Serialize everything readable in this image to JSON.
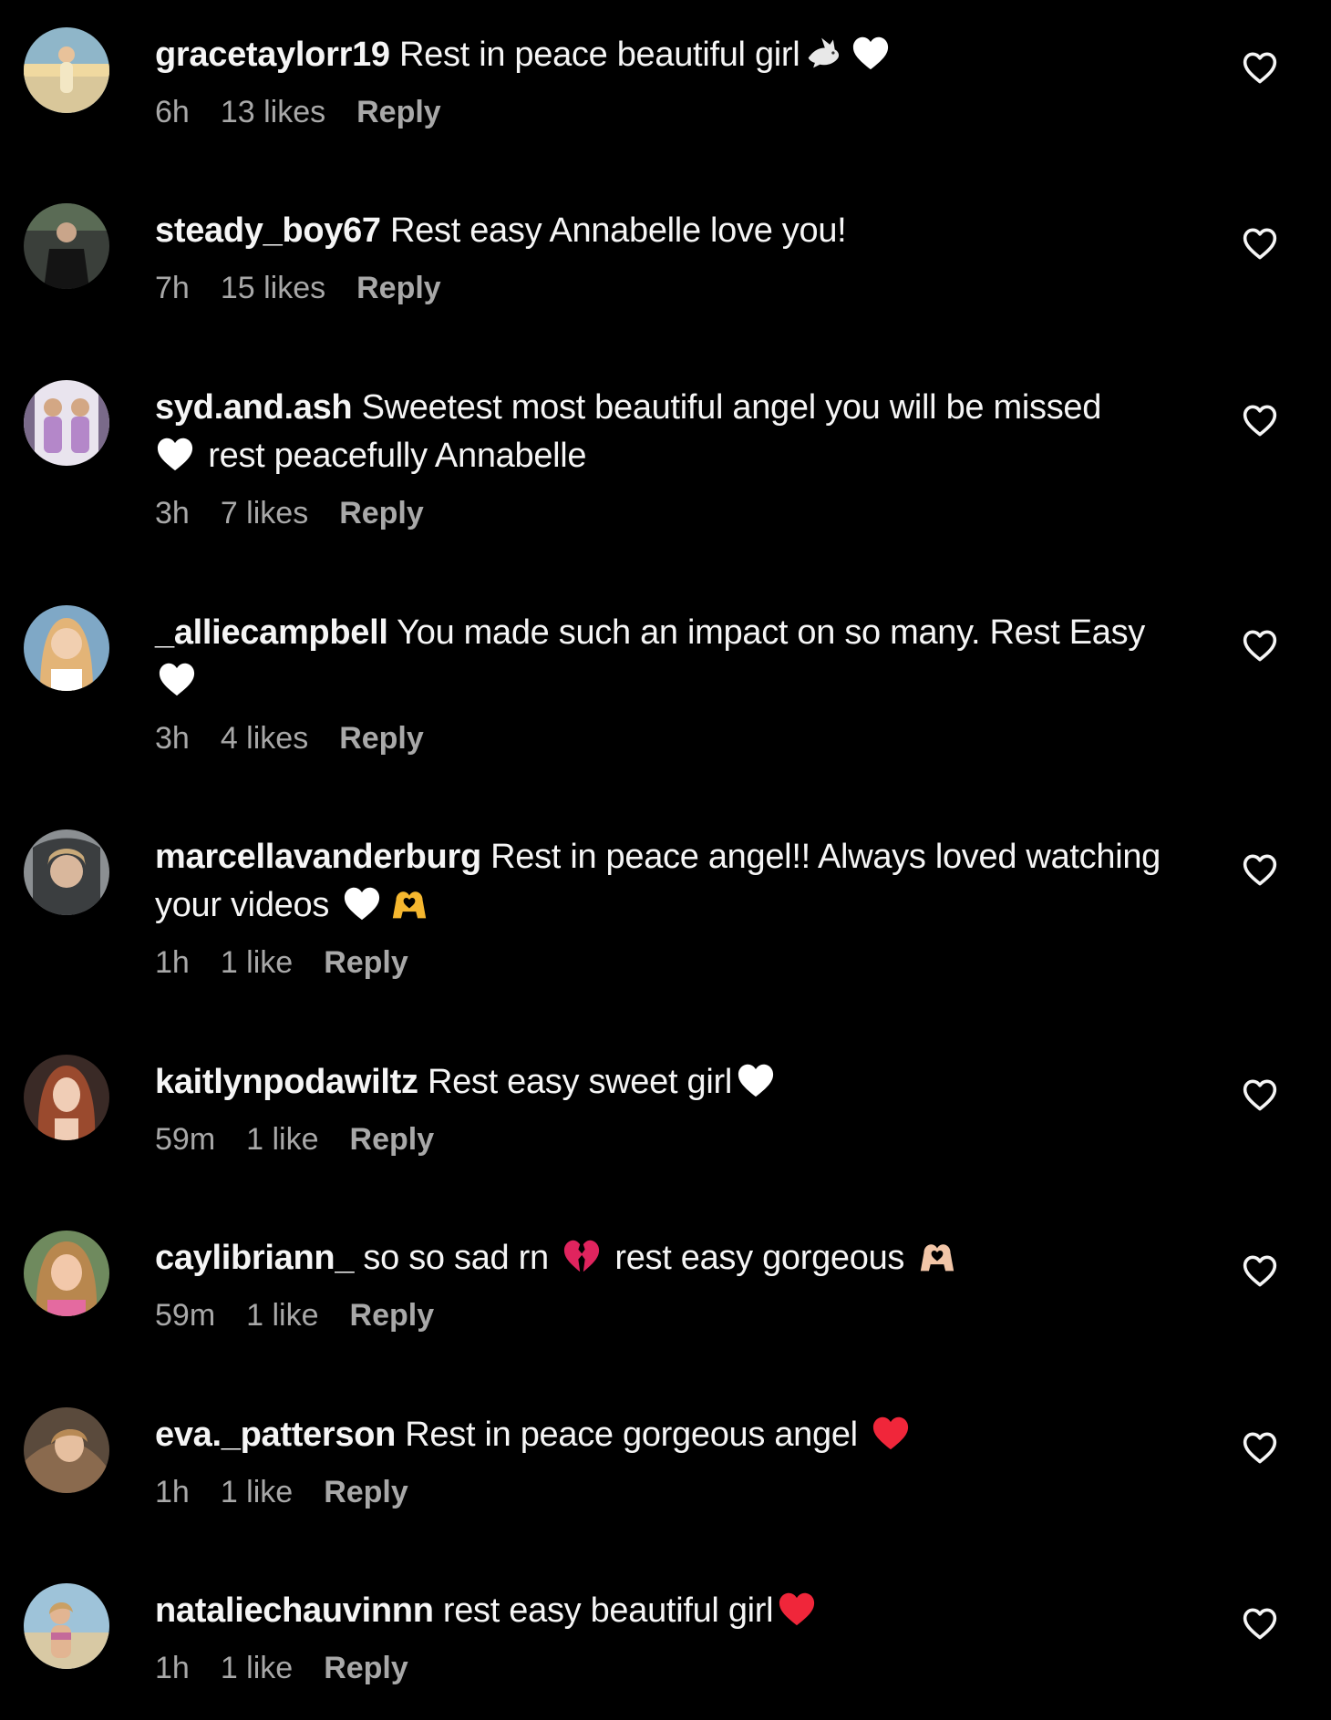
{
  "colors": {
    "background": "#000000",
    "text": "#f5f5f5",
    "meta": "#a8a8a8",
    "white_heart": "#ffffff",
    "red_heart": "#f0263a",
    "gold_hands": "#f5b72f",
    "peach_hands": "#f2c6a8"
  },
  "comments": [
    {
      "username": "gracetaylorr19",
      "text": " Rest in peace beautiful girl",
      "emoji": [
        "dove",
        "white-heart"
      ],
      "time": "6h",
      "likes": "13 likes",
      "reply": "Reply"
    },
    {
      "username": "steady_boy67",
      "text": " Rest easy Annabelle love you!",
      "emoji": [],
      "time": "7h",
      "likes": "15 likes",
      "reply": "Reply"
    },
    {
      "username": "syd.and.ash",
      "text": " Sweetest most beautiful angel you will be missed",
      "text2": " rest peacefully Annabelle",
      "emoji": [
        "white-heart"
      ],
      "time": "3h",
      "likes": "7 likes",
      "reply": "Reply"
    },
    {
      "username": "_alliecampbell",
      "text": " You made such an impact on so many. Rest Easy",
      "emoji": [
        "white-heart"
      ],
      "time": "3h",
      "likes": "4 likes",
      "reply": "Reply"
    },
    {
      "username": "marcellavanderburg",
      "text": " Rest in peace angel!! Always loved watching your videos",
      "emoji": [
        "white-heart",
        "heart-hands"
      ],
      "time": "1h",
      "likes": "1 like",
      "reply": "Reply"
    },
    {
      "username": "kaitlynpodawiltz",
      "text": " Rest easy sweet girl",
      "emoji": [
        "white-heart"
      ],
      "time": "59m",
      "likes": "1 like",
      "reply": "Reply"
    },
    {
      "username": "caylibriann_",
      "text": " so so sad rn",
      "text2": " rest easy gorgeous",
      "emoji": [
        "broken-heart",
        "heart-hands"
      ],
      "time": "59m",
      "likes": "1 like",
      "reply": "Reply"
    },
    {
      "username": "eva._patterson",
      "text": " Rest in peace gorgeous angel",
      "emoji": [
        "red-heart"
      ],
      "time": "1h",
      "likes": "1 like",
      "reply": "Reply"
    },
    {
      "username": "nataliechauvinnn",
      "text": " rest easy beautiful girl",
      "emoji": [
        "red-heart"
      ],
      "time": "1h",
      "likes": "1 like",
      "reply": "Reply"
    }
  ]
}
